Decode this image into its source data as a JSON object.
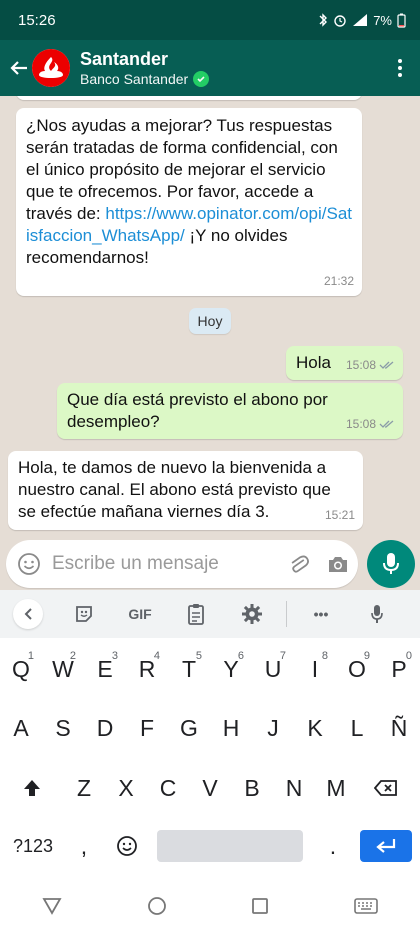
{
  "status_bar": {
    "time": "15:26",
    "battery": "7%"
  },
  "header": {
    "name": "Santander",
    "subtitle": "Banco Santander"
  },
  "messages": [
    {
      "direction": "in",
      "text_before": "¿Nos ayudas a mejorar? Tus respuestas serán tratadas de forma confidencial, con el único propósito de mejorar el servicio que te ofrecemos. Por favor, accede a través de: ",
      "link": "https://www.opinator.com/opi/Satisfaccion_WhatsApp/",
      "text_after": " ¡Y no olvides recomendarnos!",
      "time": "21:32"
    },
    {
      "direction": "out",
      "text": "Hola",
      "time": "15:08"
    },
    {
      "direction": "out",
      "text": "Que día está previsto el abono por desempleo?",
      "time": "15:08"
    },
    {
      "direction": "in",
      "text": "Hola, te damos de nuevo la bienvenida a nuestro canal. El abono está previsto que se efectúe mañana viernes día 3.",
      "time": "15:21"
    }
  ],
  "date_chip": "Hoy",
  "composer": {
    "placeholder": "Escribe un mensaje"
  },
  "keyboard": {
    "toolbar": {
      "gif": "GIF",
      "more": "•••"
    },
    "row1": [
      "Q",
      "W",
      "E",
      "R",
      "T",
      "Y",
      "U",
      "I",
      "O",
      "P"
    ],
    "row1_hints": [
      "1",
      "2",
      "3",
      "4",
      "5",
      "6",
      "7",
      "8",
      "9",
      "0"
    ],
    "row2": [
      "A",
      "S",
      "D",
      "F",
      "G",
      "H",
      "J",
      "K",
      "L",
      "Ñ"
    ],
    "row3": [
      "Z",
      "X",
      "C",
      "V",
      "B",
      "N",
      "M"
    ],
    "symbols": "?123",
    "comma": ",",
    "period": "."
  },
  "colors": {
    "header": "#075e54",
    "status_bar": "#054d44",
    "outgoing": "#dcf8c6",
    "incoming": "#ffffff",
    "accent": "#00897b",
    "enter": "#1a73e8"
  }
}
